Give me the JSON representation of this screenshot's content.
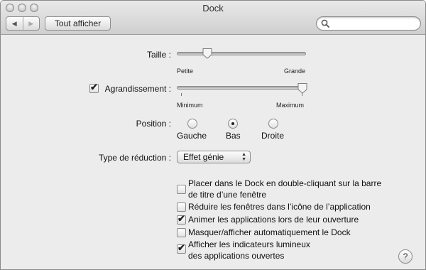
{
  "window": {
    "title": "Dock"
  },
  "toolbar": {
    "back_label": "◀",
    "forward_label": "▶",
    "show_all_label": "Tout afficher",
    "search_value": ""
  },
  "size": {
    "label": "Taille :",
    "min_label": "Petite",
    "max_label": "Grande",
    "value_fraction": 0.22
  },
  "magnification": {
    "checked": true,
    "label": "Agrandissement :",
    "min_label": "Minimum",
    "max_label": "Maximum",
    "value_fraction": 1.0
  },
  "position": {
    "label": "Position :",
    "options": [
      {
        "label": "Gauche",
        "selected": false
      },
      {
        "label": "Bas",
        "selected": true
      },
      {
        "label": "Droite",
        "selected": false
      }
    ]
  },
  "minimize": {
    "label": "Type de réduction :",
    "selected": "Effet génie"
  },
  "options": [
    {
      "label_line1": "Placer dans le Dock en double-cliquant sur la barre",
      "label_line2": "de titre d’une fenêtre",
      "checked": false
    },
    {
      "label_line1": "Réduire les fenêtres dans l’icône de l’application",
      "label_line2": "",
      "checked": false
    },
    {
      "label_line1": "Animer les applications lors de leur ouverture",
      "label_line2": "",
      "checked": true
    },
    {
      "label_line1": "Masquer/afficher automatiquement le Dock",
      "label_line2": "",
      "checked": false
    },
    {
      "label_line1": "Afficher les indicateurs lumineux",
      "label_line2": "des applications ouvertes",
      "checked": true
    }
  ],
  "help": {
    "label": "?"
  },
  "icons": {
    "checkmark": "✔",
    "popup_arrows": "▲▼"
  }
}
